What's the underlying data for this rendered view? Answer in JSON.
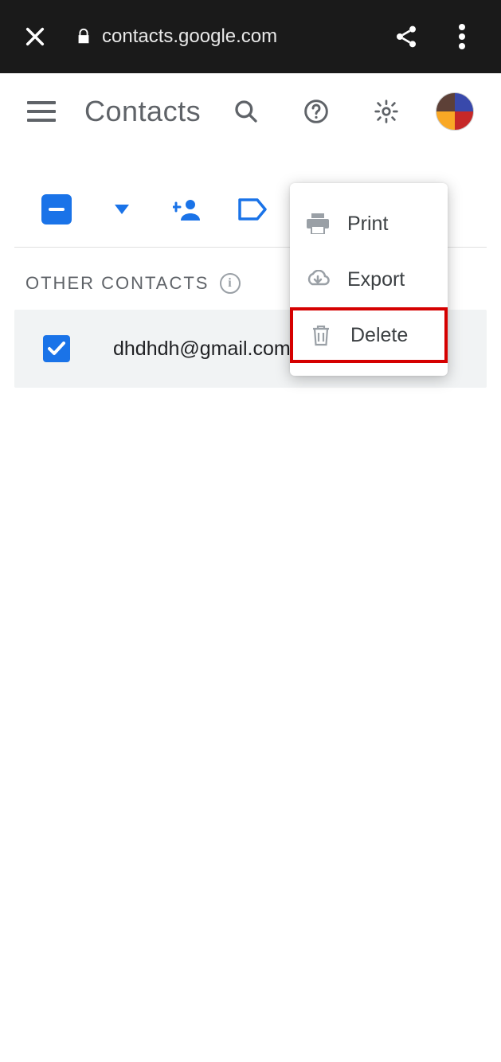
{
  "browser": {
    "url": "contacts.google.com"
  },
  "header": {
    "title": "Contacts"
  },
  "section": {
    "label": "OTHER CONTACTS"
  },
  "contacts": [
    {
      "email": "dhdhdh@gmail.com",
      "checked": true
    }
  ],
  "menu": {
    "items": [
      {
        "label": "Print"
      },
      {
        "label": "Export"
      },
      {
        "label": "Delete"
      }
    ]
  }
}
